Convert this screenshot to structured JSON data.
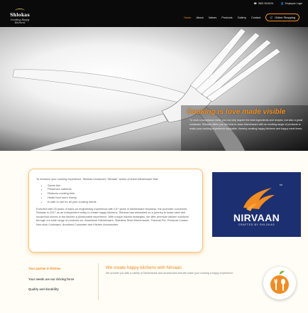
{
  "header": {
    "phone": "0820 3040191",
    "employee_login": "Employee Login",
    "logo_name": "Shlokas",
    "logo_tagline": "Creating Happy Kitchens",
    "nav": [
      "Home",
      "About",
      "Values",
      "Products",
      "Gallery",
      "Contact"
    ],
    "active_nav": "Home",
    "shop_label": "Online Shopping"
  },
  "hero": {
    "title": "Cooking is love made visible",
    "text": "To cook a sumptuous meal, you not only require the best ingredients and recipes, but also a great cookware. Shlokas offers you the best-in-class kitchenware with an exciting range of products to make your cooking experience enjoyable, thereby creating happy kitchens and happy meal times."
  },
  "intro": {
    "lead": "To enhance your cooking experience, Shlokas introduces \"Nirvaan\" series of finest kitchenware that:",
    "bullets": [
      "Saves fuel",
      "Preserves nutrients",
      "Reduces cooking time",
      "Heats food more evenly",
      "Is safe to use for all your cooking needs"
    ],
    "body": "Enriched with 25 years of hand-on engineering experience with 10+ years in kitchenware business, the promoter conceived Shlokas in 2017 as an independent entity to create happy kitchens. Shlokas has embarked on a journey to make steel dull household chores in the kitchen a pleasurable experience. With unique market strategies, we offer premium kitchen solutions through our wide range of products viz. Aluminium Kitchenware, Stainless Steel Kitchenware, Thermal Pot, Pressure Cooker, Non-stick Cookware, Anodized Cookware and Kitchen Accessories."
  },
  "nirvaan": {
    "brand": "NIRVAAN",
    "tm": "TM",
    "crafted": "CRAFTED BY SHLOKAS"
  },
  "bottom": {
    "left_items": [
      "Your partner in kitchen",
      "Your needs are our driving force",
      "Quality and durability"
    ],
    "title": "We create happy kitchens with Nirvaan",
    "text": "We provide you with a variety of kitchenware and accessories that will make your cooking a happy experience."
  },
  "colors": {
    "accent": "#f08c22",
    "header_bg": "#0a0a0a",
    "nirvaan_bg": "#1c2f70",
    "page_bg": "#fffdf6"
  },
  "icons": [
    "envelope-icon",
    "user-icon",
    "cart-icon",
    "fork-spoon-icon"
  ]
}
